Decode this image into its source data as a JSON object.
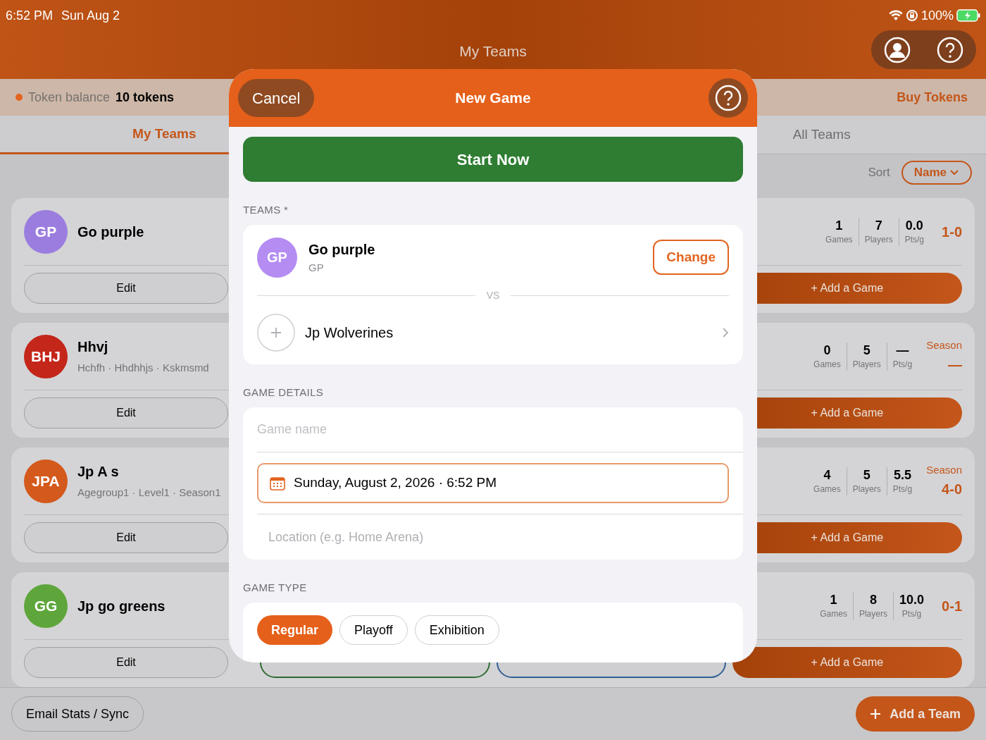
{
  "status_bar": {
    "time": "6:52 PM",
    "date": "Sun Aug 2",
    "battery": "100%"
  },
  "header": {
    "title": "My Teams"
  },
  "token_bar": {
    "label": "Token balance",
    "value": "10 tokens",
    "action": "Buy Tokens"
  },
  "tabs": [
    {
      "label": "My Teams",
      "selected": true
    },
    {
      "label": "All Teams",
      "selected": false
    }
  ],
  "sort": {
    "label": "Sort",
    "value": "Name"
  },
  "teams": [
    {
      "initials": "GP",
      "color": "#9b7ddf",
      "name": "Go purple",
      "stats": [
        {
          "value": "1",
          "label": "Games"
        },
        {
          "value": "7",
          "label": "Players"
        },
        {
          "value": "0.0",
          "label": "Pts/g"
        }
      ],
      "record": "1-0",
      "actions": [
        {
          "kind": "edit",
          "label": "Edit"
        },
        {
          "kind": "add",
          "label": "+ Add a Game"
        }
      ]
    },
    {
      "initials": "BHJ",
      "color": "#c4261a",
      "name": "Hhvj",
      "subtitle": "Hchfh · Hhdhhjs · Kskmsmd",
      "stats": [
        {
          "value": "0",
          "label": "Games"
        },
        {
          "value": "5",
          "label": "Players"
        },
        {
          "value": "—",
          "label": "Pts/g"
        }
      ],
      "season_label": "Season",
      "record": "—",
      "actions": [
        {
          "kind": "edit",
          "label": "Edit"
        },
        {
          "kind": "add",
          "label": "+ Add a Game"
        }
      ]
    },
    {
      "initials": "JPA",
      "color": "#d4591c",
      "name": "Jp A s",
      "subtitle": "Agegroup1 · Level1 · Season1",
      "stats": [
        {
          "value": "4",
          "label": "Games"
        },
        {
          "value": "5",
          "label": "Players"
        },
        {
          "value": "5.5",
          "label": "Pts/g"
        }
      ],
      "season_label": "Season",
      "record": "4-0",
      "actions": [
        {
          "kind": "edit",
          "label": "Edit"
        },
        {
          "kind": "add",
          "label": "+ Add a Game"
        }
      ]
    },
    {
      "initials": "GG",
      "color": "#5ea63b",
      "name": "Jp go greens",
      "stats": [
        {
          "value": "1",
          "label": "Games"
        },
        {
          "value": "8",
          "label": "Players"
        },
        {
          "value": "10.0",
          "label": "Pts/g"
        }
      ],
      "record": "0-1",
      "actions": [
        {
          "kind": "edit",
          "label": "Edit"
        },
        {
          "kind": "players"
        },
        {
          "kind": "games"
        },
        {
          "kind": "add",
          "label": "+ Add a Game"
        }
      ]
    }
  ],
  "bottom_bar": {
    "left_button": "Email Stats / Sync",
    "right_button": "Add a Team"
  },
  "modal": {
    "cancel": "Cancel",
    "title": "New Game",
    "start_button": "Start Now",
    "teams_section": {
      "label": "TEAMS *",
      "home": {
        "initials": "GP",
        "name": "Go purple",
        "subtitle": "GP",
        "action": "Change"
      },
      "vs": "VS",
      "opponent": "Jp Wolverines"
    },
    "details_section": {
      "label": "GAME DETAILS",
      "name_placeholder": "Game name",
      "date_value": "Sunday, August 2, 2026 · 6:52 PM",
      "location_placeholder": "Location (e.g. Home Arena)"
    },
    "type_section": {
      "label": "GAME TYPE",
      "options": [
        {
          "label": "Regular",
          "selected": true
        },
        {
          "label": "Playoff",
          "selected": false
        },
        {
          "label": "Exhibition",
          "selected": false
        }
      ]
    }
  }
}
